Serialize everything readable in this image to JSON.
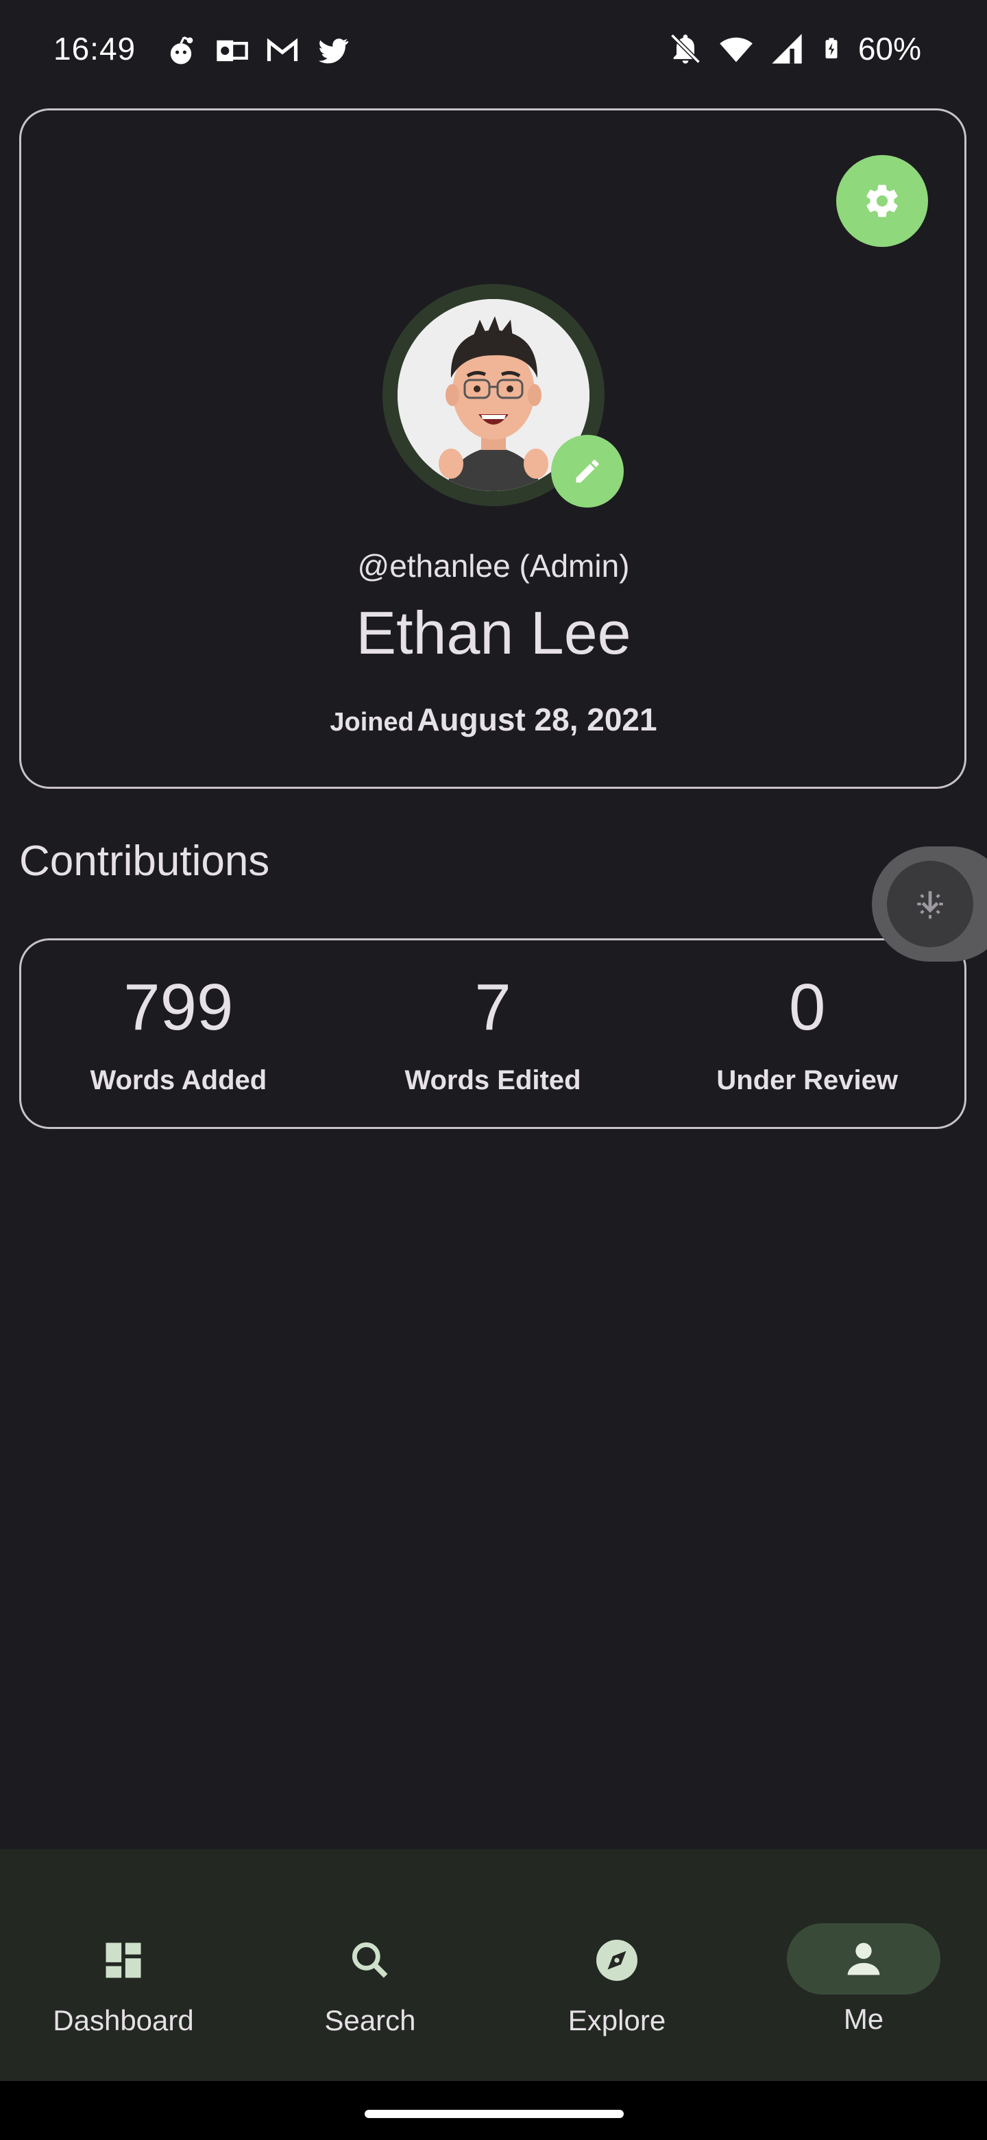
{
  "status_bar": {
    "time": "16:49",
    "battery": "60%",
    "left_icons": [
      "reddit-icon",
      "outlook-icon",
      "gmail-icon",
      "twitter-icon"
    ],
    "right_icons": [
      "bell-off-icon",
      "wifi-icon",
      "signal-icon",
      "battery-charging-icon"
    ]
  },
  "profile": {
    "username": "@ethanlee (Admin)",
    "full_name": "Ethan Lee",
    "joined_label": "Joined",
    "joined_date": "August 28, 2021"
  },
  "contributions": {
    "title": "Contributions",
    "stats": [
      {
        "value": "799",
        "label": "Words Added"
      },
      {
        "value": "7",
        "label": "Words Edited"
      },
      {
        "value": "0",
        "label": "Under Review"
      }
    ]
  },
  "nav": {
    "items": [
      {
        "label": "Dashboard",
        "icon": "dashboard-icon",
        "active": false
      },
      {
        "label": "Search",
        "icon": "search-icon",
        "active": false
      },
      {
        "label": "Explore",
        "icon": "compass-icon",
        "active": false
      },
      {
        "label": "Me",
        "icon": "person-icon",
        "active": true
      }
    ]
  },
  "colors": {
    "background": "#1c1b20",
    "accent": "#8fd87c",
    "nav_background": "#232823",
    "active_pill": "#3a4a39"
  }
}
